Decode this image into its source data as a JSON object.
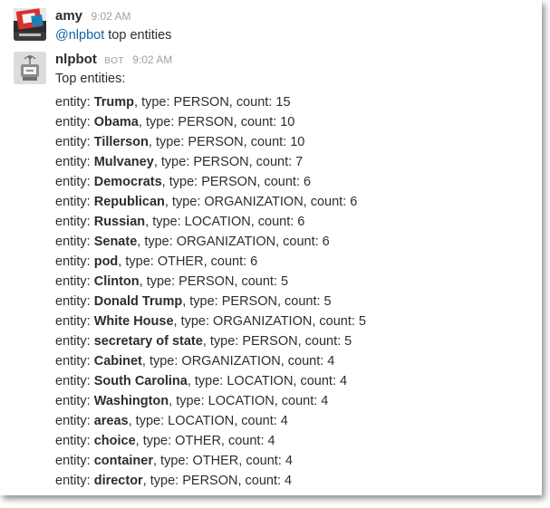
{
  "messages": [
    {
      "username": "amy",
      "time": "9:02 AM",
      "mention": "@nlpbot",
      "text": " top entities"
    },
    {
      "username": "nlpbot",
      "bot_tag": "BOT",
      "time": "9:02 AM",
      "header": "Top entities:",
      "entities": [
        {
          "prefix": "entity: ",
          "name": "Trump",
          "rest": ", type: PERSON, count: 15"
        },
        {
          "prefix": "entity: ",
          "name": "Obama",
          "rest": ", type: PERSON, count: 10"
        },
        {
          "prefix": "entity: ",
          "name": "Tillerson",
          "rest": ", type: PERSON, count: 10"
        },
        {
          "prefix": "entity: ",
          "name": "Mulvaney",
          "rest": ", type: PERSON, count: 7"
        },
        {
          "prefix": "entity: ",
          "name": "Democrats",
          "rest": ", type: PERSON, count: 6"
        },
        {
          "prefix": "entity: ",
          "name": "Republican",
          "rest": ", type: ORGANIZATION, count: 6"
        },
        {
          "prefix": "entity: ",
          "name": "Russian",
          "rest": ", type: LOCATION, count: 6"
        },
        {
          "prefix": "entity: ",
          "name": "Senate",
          "rest": ", type: ORGANIZATION, count: 6"
        },
        {
          "prefix": "entity: ",
          "name": "pod",
          "rest": ", type: OTHER, count: 6"
        },
        {
          "prefix": "entity: ",
          "name": "Clinton",
          "rest": ", type: PERSON, count: 5"
        },
        {
          "prefix": "entity: ",
          "name": "Donald Trump",
          "rest": ", type: PERSON, count: 5"
        },
        {
          "prefix": "entity: ",
          "name": "White House",
          "rest": ", type: ORGANIZATION, count: 5"
        },
        {
          "prefix": "entity: ",
          "name": "secretary of state",
          "rest": ", type: PERSON, count: 5"
        },
        {
          "prefix": "entity: ",
          "name": "Cabinet",
          "rest": ", type: ORGANIZATION, count: 4"
        },
        {
          "prefix": "entity: ",
          "name": "South Carolina",
          "rest": ", type: LOCATION, count: 4"
        },
        {
          "prefix": "entity: ",
          "name": "Washington",
          "rest": ", type: LOCATION, count: 4"
        },
        {
          "prefix": "entity: ",
          "name": "areas",
          "rest": ", type: LOCATION, count: 4"
        },
        {
          "prefix": "entity: ",
          "name": "choice",
          "rest": ", type: OTHER, count: 4"
        },
        {
          "prefix": "entity: ",
          "name": "container",
          "rest": ", type: OTHER, count: 4"
        },
        {
          "prefix": "entity: ",
          "name": "director",
          "rest": ", type: PERSON, count: 4"
        }
      ]
    }
  ],
  "colors": {
    "mention": "#1264a3",
    "username": "#2c2d30",
    "timestamp": "#a0a0a2",
    "text": "#2c2d30"
  },
  "icons": {
    "amy_avatar": "user-avatar-icon",
    "bot_avatar": "robot-avatar-icon"
  }
}
